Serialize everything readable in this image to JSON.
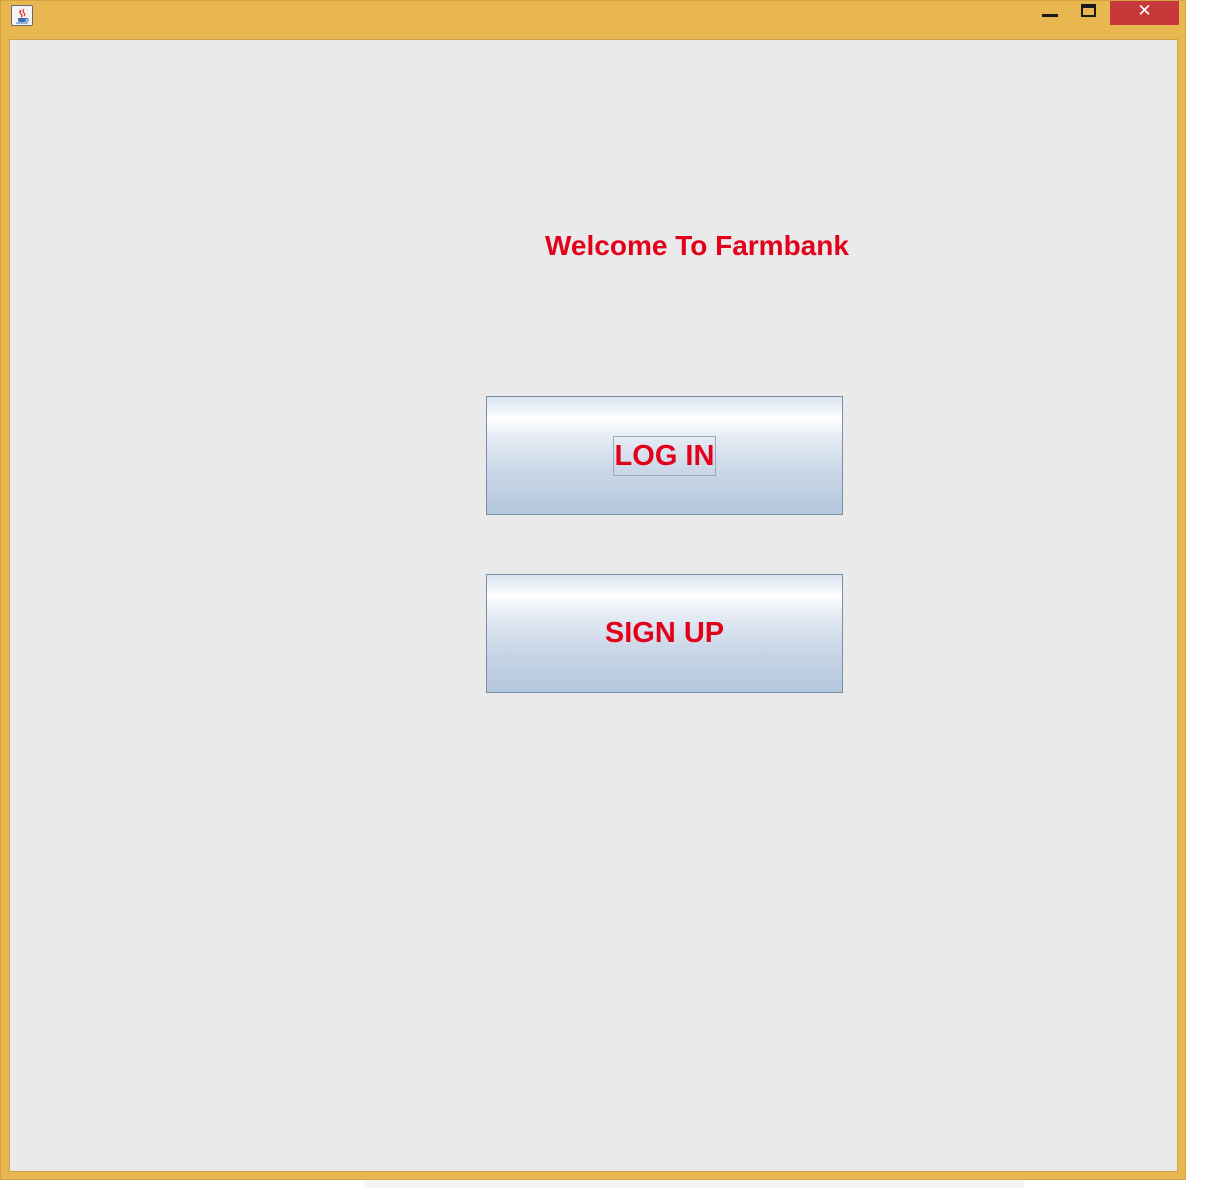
{
  "window": {
    "title_bar_color": "#e9b74f",
    "app_icon": "java-coffee-cup-icon",
    "controls": {
      "minimize_icon": "minimize-icon",
      "maximize_icon": "maximize-icon",
      "close_icon": "close-icon",
      "close_glyph": "✕"
    }
  },
  "main": {
    "welcome_text": "Welcome To Farmbank",
    "text_color": "#e3001b",
    "login_label": "LOG IN",
    "signup_label": "SIGN UP",
    "login_focused": true
  }
}
